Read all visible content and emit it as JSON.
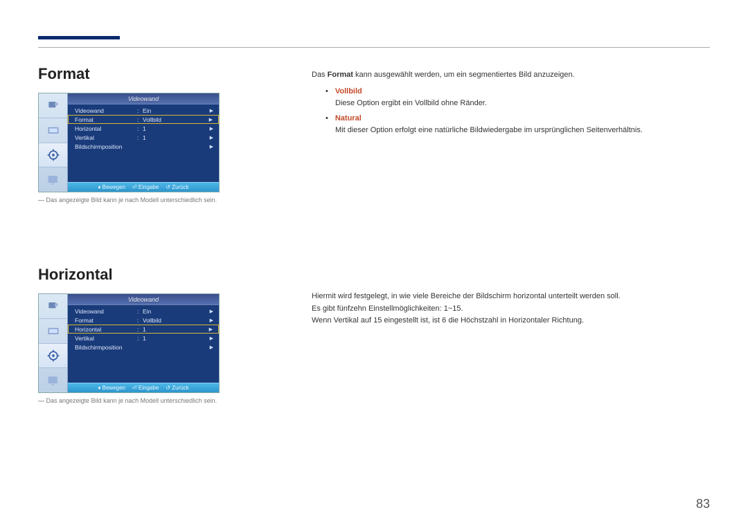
{
  "page_number": "83",
  "section_format": {
    "heading": "Format",
    "caption": "Das angezeigte Bild kann je nach Modell unterschiedlich sein.",
    "osd": {
      "title": "Videowand",
      "selected_index": 1,
      "rows": [
        {
          "label": "Videowand",
          "value": "Ein",
          "has_arrow": true
        },
        {
          "label": "Format",
          "value": "Vollbild",
          "has_arrow": true
        },
        {
          "label": "Horizontal",
          "value": "1",
          "has_arrow": true
        },
        {
          "label": "Vertikal",
          "value": "1",
          "has_arrow": true
        },
        {
          "label": "Bildschirmposition",
          "value": "",
          "has_arrow": true
        }
      ],
      "footer": {
        "move": "Bewegen",
        "enter": "Eingabe",
        "back": "Zurück"
      }
    },
    "body": {
      "intro_pre": "Das ",
      "intro_bold": "Format",
      "intro_post": " kann ausgewählt werden, um ein segmentiertes Bild anzuzeigen.",
      "options": [
        {
          "name": "Vollbild",
          "desc": "Diese Option ergibt ein Vollbild ohne Ränder."
        },
        {
          "name": "Natural",
          "desc": "Mit dieser Option erfolgt eine natürliche Bildwiedergabe im ursprünglichen Seitenverhältnis."
        }
      ]
    }
  },
  "section_horizontal": {
    "heading": "Horizontal",
    "caption": "Das angezeigte Bild kann je nach Modell unterschiedlich sein.",
    "osd": {
      "title": "Videowand",
      "selected_index": 2,
      "rows": [
        {
          "label": "Videowand",
          "value": "Ein",
          "has_arrow": true
        },
        {
          "label": "Format",
          "value": "Vollbild",
          "has_arrow": true
        },
        {
          "label": "Horizontal",
          "value": "1",
          "has_arrow": true
        },
        {
          "label": "Vertikal",
          "value": "1",
          "has_arrow": true
        },
        {
          "label": "Bildschirmposition",
          "value": "",
          "has_arrow": true
        }
      ],
      "footer": {
        "move": "Bewegen",
        "enter": "Eingabe",
        "back": "Zurück"
      }
    },
    "body": {
      "line1": "Hiermit wird festgelegt, in wie viele Bereiche der Bildschirm horizontal unterteilt werden soll.",
      "line2": "Es gibt fünfzehn Einstellmöglichkeiten: 1~15.",
      "note_pre": "Wenn ",
      "note_vert": "Vertikal",
      "note_mid1": " auf ",
      "note_15": "15",
      "note_mid2": " eingestellt ist, ist ",
      "note_6": "6",
      "note_mid3": " die Höchstzahl in ",
      "note_horiz": "Horizontal",
      "note_post": "er Richtung."
    }
  }
}
